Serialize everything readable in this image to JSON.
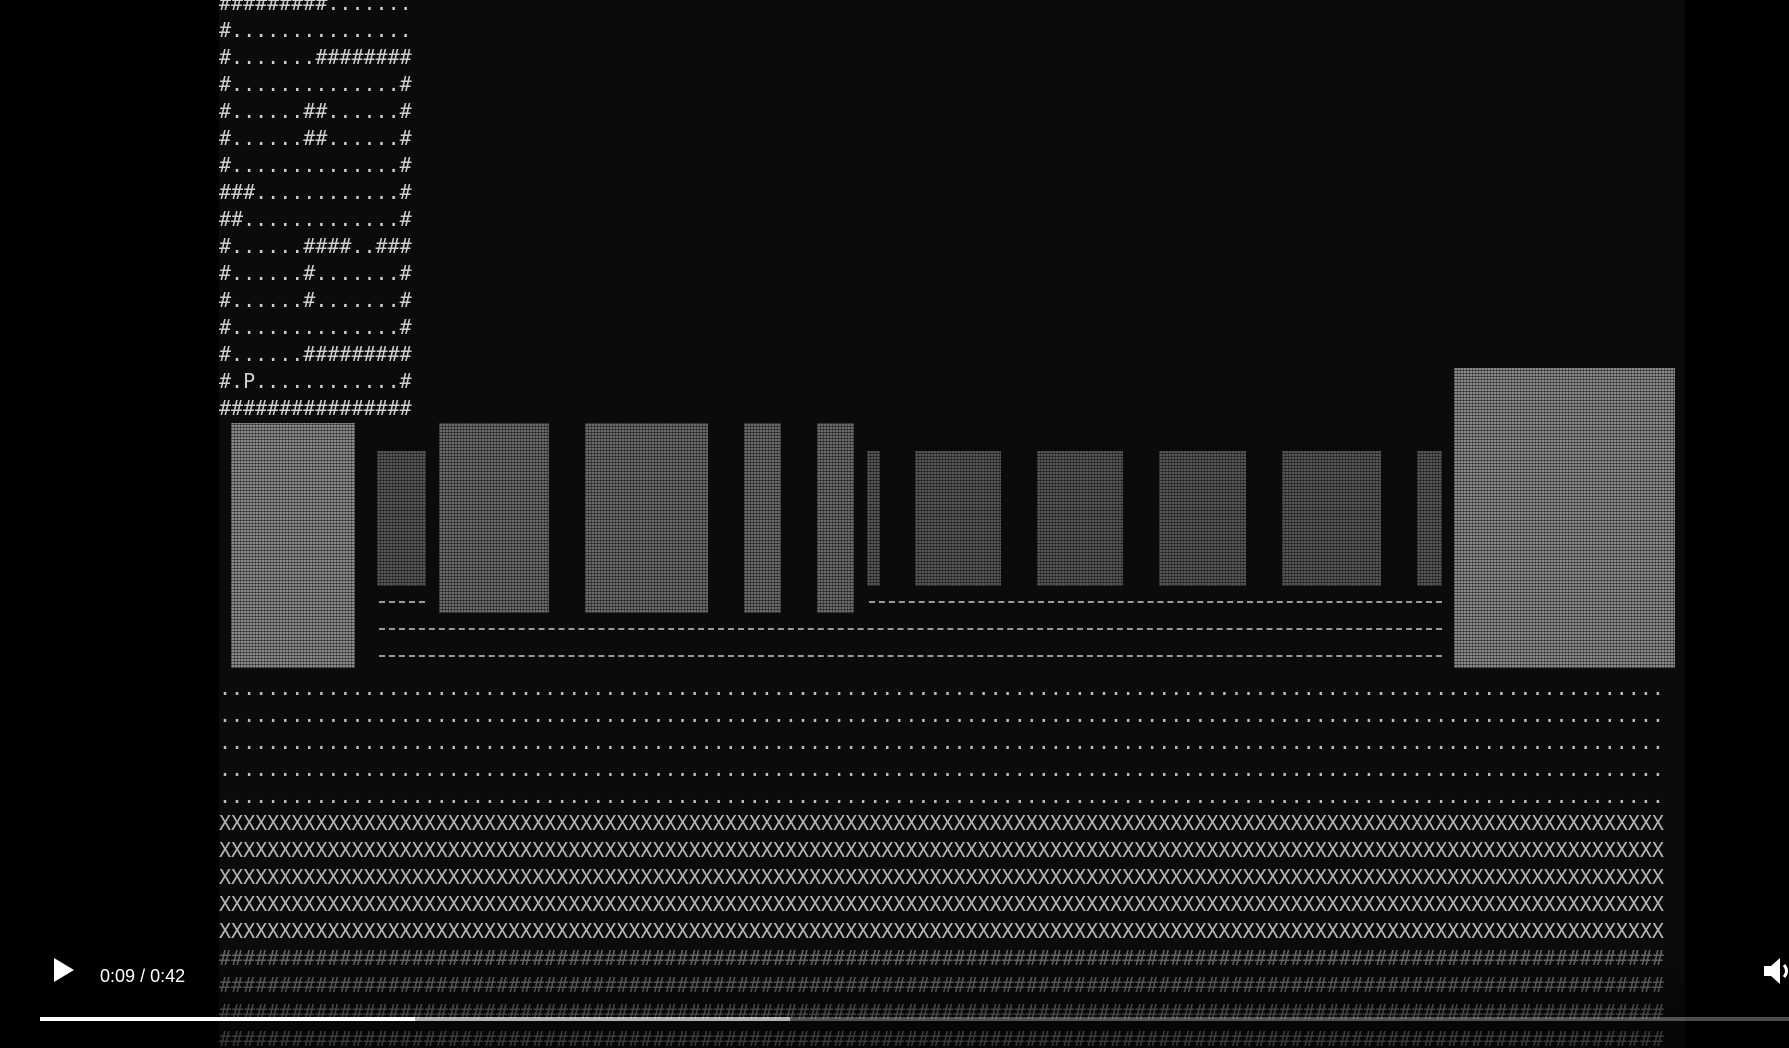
{
  "screen": {
    "map_lines": [
      "#########.......",
      "#...............",
      "#.......########",
      "#..............#",
      "#......##......#",
      "#......##......#",
      "#..............#",
      "###............#",
      "##.............#",
      "#......####..###",
      "#......#.......#",
      "#......#.......#",
      "#..............#",
      "#......#########",
      "#.P............#",
      "################"
    ],
    "dot_lines": [
      "........................................................................................................................",
      "........................................................................................................................",
      "........................................................................................................................",
      "........................................................................................................................",
      "........................................................................................................................"
    ],
    "x_lines": [
      "XXXXXXXXXXXXXXXXXXXXXXXXXXXXXXXXXXXXXXXXXXXXXXXXXXXXXXXXXXXXXXXXXXXXXXXXXXXXXXXXXXXXXXXXXXXXXXXXXXXXXXXXXXXXXXXXXXXXXXXX",
      "XXXXXXXXXXXXXXXXXXXXXXXXXXXXXXXXXXXXXXXXXXXXXXXXXXXXXXXXXXXXXXXXXXXXXXXXXXXXXXXXXXXXXXXXXXXXXXXXXXXXXXXXXXXXXXXXXXXXXXXX",
      "XXXXXXXXXXXXXXXXXXXXXXXXXXXXXXXXXXXXXXXXXXXXXXXXXXXXXXXXXXXXXXXXXXXXXXXXXXXXXXXXXXXXXXXXXXXXXXXXXXXXXXXXXXXXXXXXXXXXXXXX",
      "XXXXXXXXXXXXXXXXXXXXXXXXXXXXXXXXXXXXXXXXXXXXXXXXXXXXXXXXXXXXXXXXXXXXXXXXXXXXXXXXXXXXXXXXXXXXXXXXXXXXXXXXXXXXXXXXXXXXXXXX",
      "XXXXXXXXXXXXXXXXXXXXXXXXXXXXXXXXXXXXXXXXXXXXXXXXXXXXXXXXXXXXXXXXXXXXXXXXXXXXXXXXXXXXXXXXXXXXXXXXXXXXXXXXXXXXXXXXXXXXXXXX"
    ],
    "hash_lines": [
      "########################################################################################################################",
      "########################################################################################################################",
      "########################################################################################################################",
      "########################################################################################################################"
    ]
  },
  "player": {
    "play_icon": "play-icon",
    "volume_icon": "volume-icon",
    "current_time": "0:09",
    "duration": "0:42",
    "time_text": "0:09 / 0:42",
    "played_fraction": 0.2143,
    "buffered_fraction": 0.4286
  },
  "colors": {
    "background": "#000000",
    "frame": "#0b0b0d",
    "text": "#cfcfcf",
    "controls": "#ffffff"
  }
}
